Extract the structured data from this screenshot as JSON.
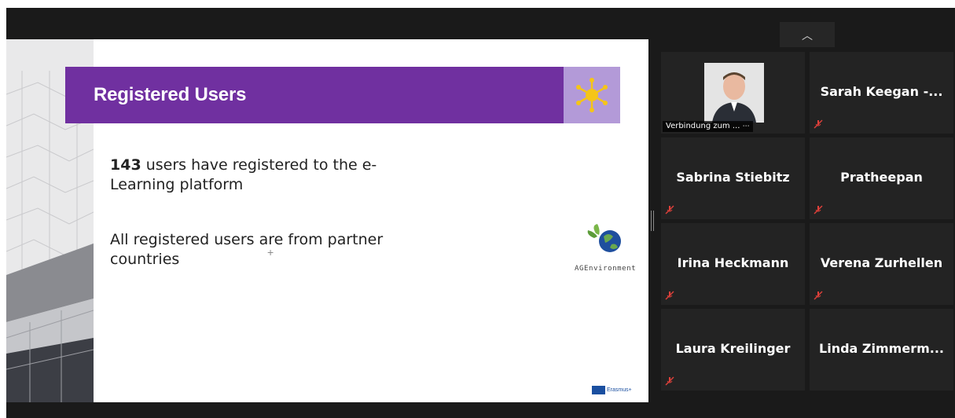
{
  "controls": {
    "collapse_icon": "chevron-up-icon",
    "collapse_glyph": "︿"
  },
  "slide": {
    "title": "Registered Users",
    "count": "143",
    "line1_rest": " users have registered to the e-",
    "line2": "Learning platform",
    "line3": "All registered users are from partner",
    "line4": "countries",
    "logo_text": "AGEnvironment",
    "erasmus_text": "Erasmus+",
    "banner_color": "#7030a0",
    "banner_icon_bg": "#b39ad8",
    "sun_color": "#f5c518"
  },
  "participants": [
    {
      "name": "",
      "label": "Verbindung zum ...",
      "has_video": true
    },
    {
      "name": "Sarah  Keegan -...",
      "muted": true
    },
    {
      "name": "Sabrina Stiebitz",
      "muted": true
    },
    {
      "name": "Pratheepan",
      "muted": true
    },
    {
      "name": "Irina Heckmann",
      "muted": true
    },
    {
      "name": "Verena Zurhellen",
      "muted": true
    },
    {
      "name": "Laura Kreilinger",
      "muted": true
    },
    {
      "name": "Linda  Zimmerm...",
      "muted": true
    }
  ],
  "colors": {
    "mute_red": "#e0403a",
    "tile_bg": "#232323",
    "app_bg": "#1a1a1a"
  }
}
